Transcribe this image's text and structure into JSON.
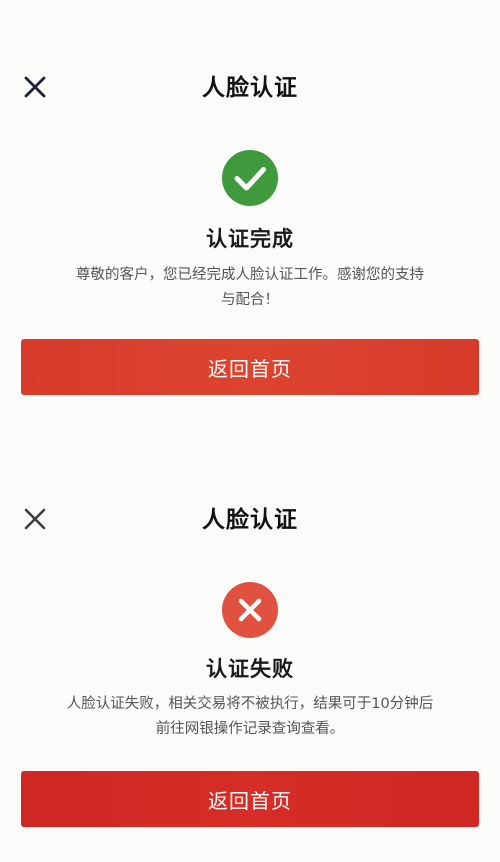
{
  "success": {
    "header": {
      "title": "人脸认证",
      "close_icon": "close-icon"
    },
    "status": {
      "icon": "check-circle-icon",
      "icon_color": "#3e9a3c",
      "title": "认证完成",
      "message": "尊敬的客户，您已经完成人脸认证工作。感谢您的支持与配合！"
    },
    "button": {
      "label": "返回首页",
      "color": "#d9412d"
    }
  },
  "failure": {
    "header": {
      "title": "人脸认证",
      "close_icon": "close-icon"
    },
    "status": {
      "icon": "cross-circle-icon",
      "icon_color": "#e0513f",
      "title": "认证失败",
      "message": "人脸认证失败，相关交易将不被执行，结果可于10分钟后前往网银操作记录查询查看。"
    },
    "button": {
      "label": "返回首页",
      "color": "#d42a24"
    }
  }
}
